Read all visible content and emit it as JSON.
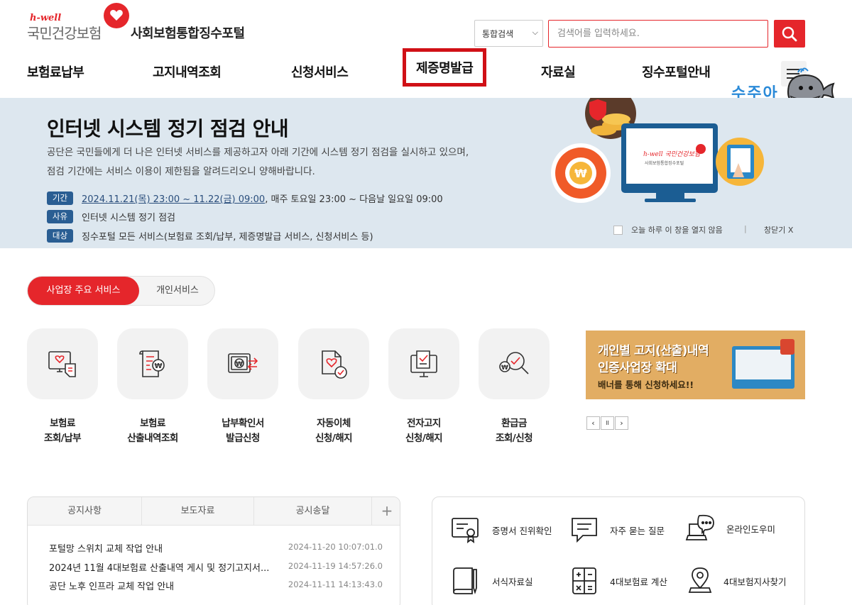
{
  "header": {
    "logo_hwell": "h-well",
    "logo_main": "국민건강보험",
    "logo_portal": "사회보험통합징수포털",
    "search_select": "통합검색",
    "search_placeholder": "검색어를 입력하세요."
  },
  "gnb": [
    "보험료납부",
    "고지내역조회",
    "신청서비스",
    "제증명발급",
    "자료실",
    "징수포털안내"
  ],
  "mascot_text": "수주아",
  "banner": {
    "title": "인터넷 시스템 정기 점검 안내",
    "desc1": "공단은 국민들에게 더 나은 인터넷 서비스를 제공하고자 아래 기간에 시스템 정기 점검을 실시하고 있으며,",
    "desc2": "점검 기간에는 서비스 이용이 제한됨을 알려드리오니 양해바랍니다.",
    "rows": [
      {
        "tag": "기간",
        "text_u": "2024.11.21(목) 23:00 ~ 11.22(금) 09:00",
        "text": ", 매주 토요일 23:00 ~ 다음날 일요일 09:00"
      },
      {
        "tag": "사유",
        "text_u": "",
        "text": "인터넷 시스템 정기 점검"
      },
      {
        "tag": "대상",
        "text_u": "",
        "text": "징수포털 모든 서비스(보험료 조회/납부, 제증명발급 서비스, 신청서비스 등)"
      }
    ],
    "no_show_today": "오늘 하루 이 창을 열지 않음",
    "sep": "|",
    "close": "창닫기 X",
    "monitor_logo": "h-well 국민건강보험",
    "monitor_sub": "사회보험통합징수포털"
  },
  "service_tabs": {
    "active": "사업장 주요 서비스",
    "other": "개인서비스"
  },
  "services": [
    {
      "line1": "보험료",
      "line2": "조회/납부",
      "icon": "bill-icon"
    },
    {
      "line1": "보험료",
      "line2": "산출내역조회",
      "icon": "calc-doc-icon"
    },
    {
      "line1": "납부확인서",
      "line2": "발급신청",
      "icon": "payment-cert-icon"
    },
    {
      "line1": "자동이체",
      "line2": "신청/해지",
      "icon": "auto-transfer-icon"
    },
    {
      "line1": "전자고지",
      "line2": "신청/해지",
      "icon": "e-notice-icon"
    },
    {
      "line1": "환급금",
      "line2": "조회/신청",
      "icon": "refund-search-icon"
    }
  ],
  "ad": {
    "line1": "개인별 고지(산출)내역",
    "line2": "인증사업장 확대",
    "line3": "배너를 통해 신청하세요!!",
    "prev": "‹",
    "pause": "II",
    "next": "›"
  },
  "board": {
    "tabs": [
      "공지사항",
      "보도자료",
      "공시송달"
    ],
    "plus": "+",
    "notices": [
      {
        "title": "포털망 스위치 교체 작업 안내",
        "date": "2024-11-20 10:07:01.0"
      },
      {
        "title": "2024년 11월 4대보험료 산출내역 게시 및 정기고지서...",
        "date": "2024-11-19 14:57:26.0"
      },
      {
        "title": "공단 노후 인프라 교체 작업 안내",
        "date": "2024-11-11 14:13:43.0"
      }
    ]
  },
  "quick_links": [
    {
      "label": "증명서 진위확인",
      "icon": "certificate-icon"
    },
    {
      "label": "자주 묻는 질문",
      "icon": "faq-chat-icon"
    },
    {
      "label": "온라인도우미",
      "icon": "online-helper-icon"
    },
    {
      "label": "서식자료실",
      "icon": "form-book-icon"
    },
    {
      "label": "4대보험료 계산",
      "icon": "calculator-icon"
    },
    {
      "label": "4대보험지사찾기",
      "icon": "location-pin-icon"
    }
  ],
  "colors": {
    "accent": "#e5262b",
    "banner_bg": "#dde7ef",
    "tag": "#2a5e93",
    "ad_bg": "#e2ad63"
  }
}
